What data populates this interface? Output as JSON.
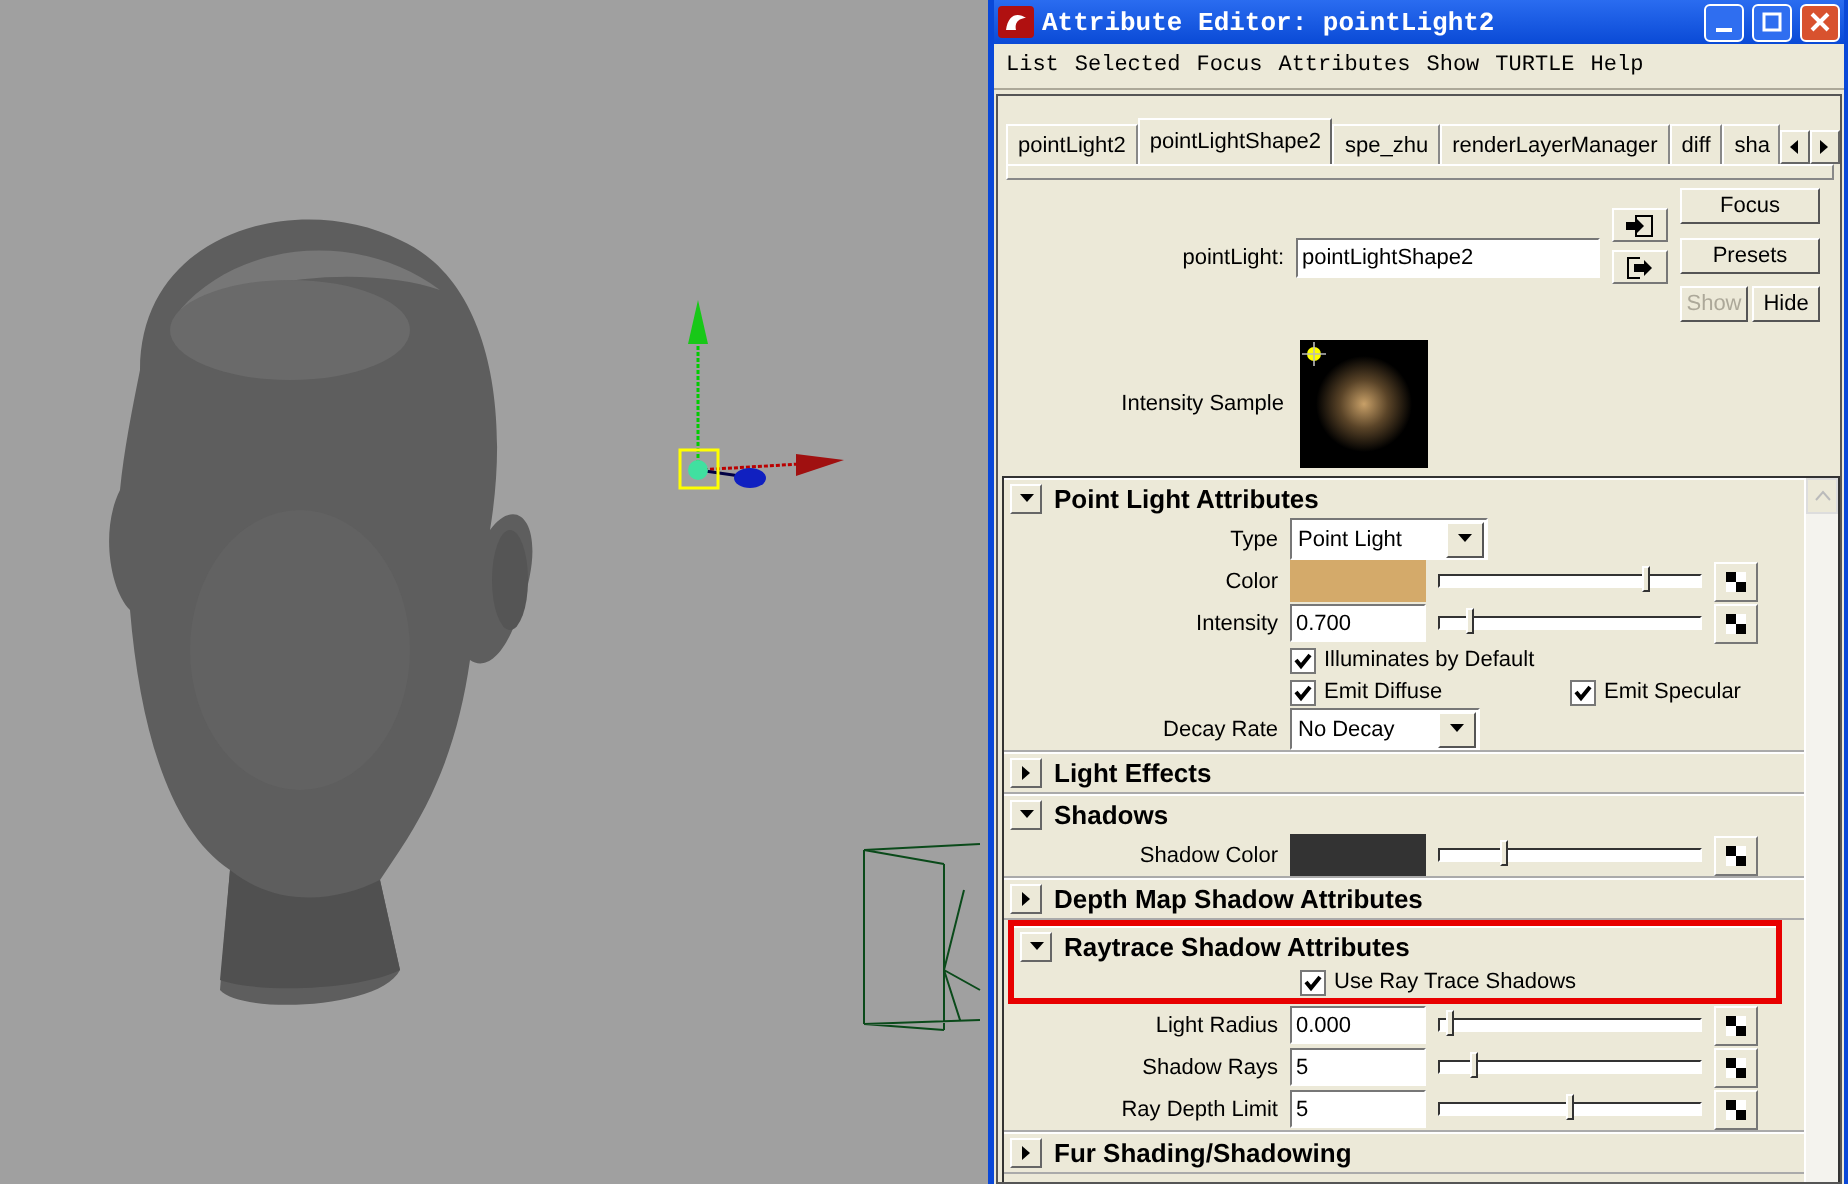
{
  "window": {
    "title": "Attribute Editor: pointLight2"
  },
  "menu": [
    "List",
    "Selected",
    "Focus",
    "Attributes",
    "Show",
    "TURTLE",
    "Help"
  ],
  "tabs": [
    {
      "label": "pointLight2",
      "selected": false
    },
    {
      "label": "pointLightShape2",
      "selected": true
    },
    {
      "label": "spe_zhu",
      "selected": false
    },
    {
      "label": "renderLayerManager",
      "selected": false
    },
    {
      "label": "diff",
      "selected": false
    },
    {
      "label": "sha",
      "selected": false
    }
  ],
  "node": {
    "label": "pointLight:",
    "value": "pointLightShape2"
  },
  "buttons": [
    {
      "label": "Focus",
      "disabled": false
    },
    {
      "label": "Presets",
      "disabled": false
    },
    {
      "label": "Show",
      "disabled": true
    },
    {
      "label": "Hide",
      "disabled": false
    }
  ],
  "sample": {
    "label": "Intensity Sample"
  },
  "sections": [
    {
      "title": "Point Light Attributes",
      "expanded": true,
      "highlighted": false,
      "rows": [
        {
          "kind": "dropdown",
          "label": "Type",
          "value": "Point Light"
        },
        {
          "kind": "color",
          "label": "Color",
          "color": "#d4aa6a",
          "level": 0.8
        },
        {
          "kind": "number",
          "label": "Intensity",
          "value": "0.700",
          "level": 0.1
        },
        {
          "kind": "checks",
          "items": [
            {
              "label": "Illuminates by Default",
              "checked": true
            }
          ]
        },
        {
          "kind": "checks",
          "items": [
            {
              "label": "Emit Diffuse",
              "checked": true
            },
            {
              "label": "Emit Specular",
              "checked": true
            }
          ]
        },
        {
          "kind": "dropdown",
          "label": "Decay Rate",
          "value": "No Decay"
        }
      ]
    },
    {
      "title": "Light Effects",
      "expanded": false,
      "highlighted": false
    },
    {
      "title": "Shadows",
      "expanded": true,
      "highlighted": false,
      "rows": [
        {
          "kind": "color",
          "label": "Shadow Color",
          "color": "#333333",
          "level": 0.24
        }
      ]
    },
    {
      "title": "Depth Map Shadow Attributes",
      "expanded": false,
      "highlighted": false
    },
    {
      "title": "Raytrace Shadow Attributes",
      "expanded": true,
      "highlighted": true,
      "rows": [
        {
          "kind": "checks",
          "items": [
            {
              "label": "Use Ray Trace Shadows",
              "checked": true
            }
          ]
        },
        {
          "kind": "number",
          "label": "Light Radius",
          "value": "0.000",
          "level": 0.02
        },
        {
          "kind": "number",
          "label": "Shadow Rays",
          "value": "5",
          "level": 0.12
        },
        {
          "kind": "number",
          "label": "Ray Depth Limit",
          "value": "5",
          "level": 0.5
        }
      ]
    },
    {
      "title": "Fur Shading/Shadowing",
      "expanded": false,
      "highlighted": false
    }
  ]
}
